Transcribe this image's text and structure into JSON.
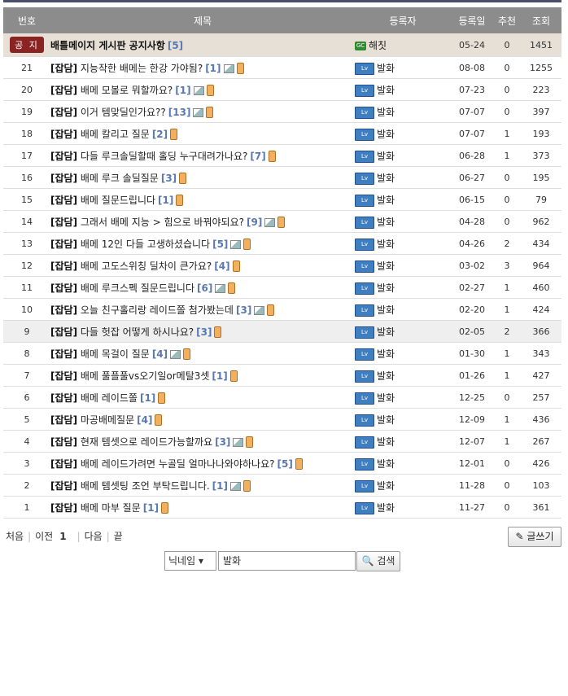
{
  "headers": {
    "num": "번호",
    "title": "제목",
    "writer": "등록자",
    "date": "등록일",
    "rec": "추천",
    "view": "조회"
  },
  "notice": {
    "badge": "공 지",
    "title": "배틀메이지 게시판 공지사항",
    "count": "[5]",
    "gm_icon": "GC",
    "writer": "해칫",
    "date": "05-24",
    "rec": "0",
    "view": "1451"
  },
  "posts": [
    {
      "num": "21",
      "cat": "[잡담]",
      "title": "지능작한 배메는 한강 가야됨?",
      "count": "[1]",
      "img": true,
      "writer": "발화",
      "date": "08-08",
      "rec": "0",
      "view": "1255"
    },
    {
      "num": "20",
      "cat": "[잡담]",
      "title": "배메 모볼로 뭐할까요?",
      "count": "[1]",
      "img": true,
      "writer": "발화",
      "date": "07-23",
      "rec": "0",
      "view": "223"
    },
    {
      "num": "19",
      "cat": "[잡담]",
      "title": "이거 템맞딜인가요??",
      "count": "[13]",
      "img": true,
      "writer": "발화",
      "date": "07-07",
      "rec": "0",
      "view": "397"
    },
    {
      "num": "18",
      "cat": "[잡담]",
      "title": "배메 칼리고 질문",
      "count": "[2]",
      "img": false,
      "writer": "발화",
      "date": "07-07",
      "rec": "1",
      "view": "193"
    },
    {
      "num": "17",
      "cat": "[잡담]",
      "title": "다들 루크솔딜할때 홀딩 누구대려가나요?",
      "count": "[7]",
      "img": false,
      "writer": "발화",
      "date": "06-28",
      "rec": "1",
      "view": "373"
    },
    {
      "num": "16",
      "cat": "[잡담]",
      "title": "배메 루크 솔딜질문",
      "count": "[3]",
      "img": false,
      "writer": "발화",
      "date": "06-27",
      "rec": "0",
      "view": "195"
    },
    {
      "num": "15",
      "cat": "[잡담]",
      "title": "배메 질문드립니다",
      "count": "[1]",
      "img": false,
      "writer": "발화",
      "date": "06-15",
      "rec": "0",
      "view": "79"
    },
    {
      "num": "14",
      "cat": "[잡담]",
      "title": "그래서 배메 지능 > 힘으로 바꿔야되요?",
      "count": "[9]",
      "img": true,
      "writer": "발화",
      "date": "04-28",
      "rec": "0",
      "view": "962"
    },
    {
      "num": "13",
      "cat": "[잡담]",
      "title": "배메 12인 다들 고생하셨습니다",
      "count": "[5]",
      "img": true,
      "writer": "발화",
      "date": "04-26",
      "rec": "2",
      "view": "434"
    },
    {
      "num": "12",
      "cat": "[잡담]",
      "title": "배메 고도스위칭 딜차이 큰가요?",
      "count": "[4]",
      "img": false,
      "writer": "발화",
      "date": "03-02",
      "rec": "3",
      "view": "964"
    },
    {
      "num": "11",
      "cat": "[잡담]",
      "title": "배메 루크스펙 질문드립니다",
      "count": "[6]",
      "img": true,
      "writer": "발화",
      "date": "02-27",
      "rec": "1",
      "view": "460"
    },
    {
      "num": "10",
      "cat": "[잡담]",
      "title": "오늘 친구홀리랑 레이드쫄 첨가봤는데",
      "count": "[3]",
      "img": true,
      "writer": "발화",
      "date": "02-20",
      "rec": "1",
      "view": "424"
    },
    {
      "num": "9",
      "cat": "[잡담]",
      "title": "다들 헛잡 어떻게 하시나요?",
      "count": "[3]",
      "img": false,
      "writer": "발화",
      "date": "02-05",
      "rec": "2",
      "view": "366",
      "hl": true
    },
    {
      "num": "8",
      "cat": "[잡담]",
      "title": "배메 목걸이 질문",
      "count": "[4]",
      "img": true,
      "writer": "발화",
      "date": "01-30",
      "rec": "1",
      "view": "343"
    },
    {
      "num": "7",
      "cat": "[잡담]",
      "title": "배메 풀플풀vs오기일or메탈3셋",
      "count": "[1]",
      "img": false,
      "writer": "발화",
      "date": "01-26",
      "rec": "1",
      "view": "427"
    },
    {
      "num": "6",
      "cat": "[잡담]",
      "title": "배메 레이드쫄",
      "count": "[1]",
      "img": false,
      "writer": "발화",
      "date": "12-25",
      "rec": "0",
      "view": "257"
    },
    {
      "num": "5",
      "cat": "[잡담]",
      "title": "마공배메질문",
      "count": "[4]",
      "img": false,
      "writer": "발화",
      "date": "12-09",
      "rec": "1",
      "view": "436"
    },
    {
      "num": "4",
      "cat": "[잡담]",
      "title": "현재 템셋으로 레이드가능할까요",
      "count": "[3]",
      "img": true,
      "writer": "발화",
      "date": "12-07",
      "rec": "1",
      "view": "267"
    },
    {
      "num": "3",
      "cat": "[잡담]",
      "title": "배메 레이드가려면 누골딜 얼마나나와야하나요?",
      "count": "[5]",
      "img": false,
      "writer": "발화",
      "date": "12-01",
      "rec": "0",
      "view": "426"
    },
    {
      "num": "2",
      "cat": "[잡담]",
      "title": "배메 템셋팅 조언 부탁드립니다.",
      "count": "[1]",
      "img": true,
      "writer": "발화",
      "date": "11-28",
      "rec": "0",
      "view": "103"
    },
    {
      "num": "1",
      "cat": "[잡담]",
      "title": "배메 마부 질문",
      "count": "[1]",
      "img": false,
      "writer": "발화",
      "date": "11-27",
      "rec": "0",
      "view": "361"
    }
  ],
  "pagination": {
    "first": "처음",
    "prev": "이전",
    "current": "1",
    "next": "다음",
    "last": "끝"
  },
  "write_button": "글쓰기",
  "search": {
    "type": "닉네임",
    "value": "발화",
    "button": "검색"
  },
  "colors": {
    "header_bg": "#8c8c8c",
    "notice_bg": "#e7e0d6",
    "badge": "#8b2323",
    "count": "#5a78b0"
  }
}
